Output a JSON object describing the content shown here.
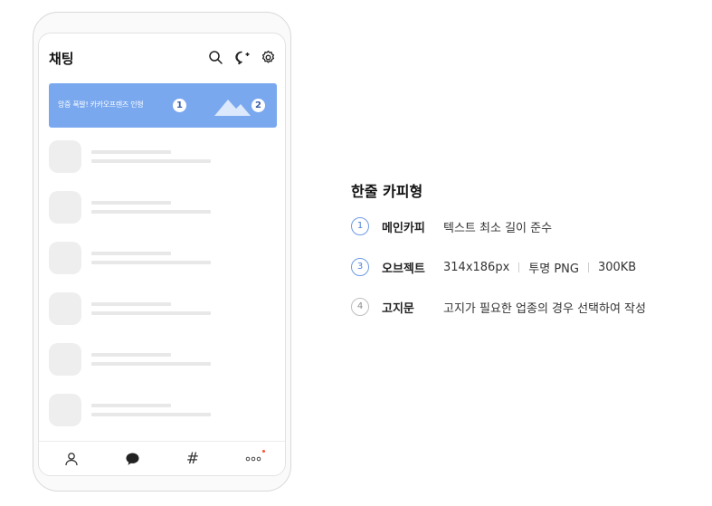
{
  "phone": {
    "title": "채팅",
    "banner_text": "앙증 폭발! 카카오프렌즈 인형",
    "banner_badge_1": "1",
    "banner_badge_2": "2",
    "chat_rows": 6,
    "tabs": [
      "friends-icon",
      "chat-bubble-icon",
      "hash-icon",
      "more-icon"
    ],
    "hash_glyph": "#"
  },
  "spec": {
    "title": "한줄 카피형",
    "rows": [
      {
        "num": "1",
        "label": "메인카피",
        "value": "텍스트 최소 길이 준수"
      },
      {
        "num": "3",
        "label": "오브젝트",
        "values": [
          "314x186px",
          "투명 PNG",
          "300KB"
        ]
      },
      {
        "num": "4",
        "label": "고지문",
        "value": "고지가 필요한 업종의 경우 선택하여 작성"
      }
    ]
  },
  "colors": {
    "banner": "#7aa8ef",
    "accent": "#4b7fd6",
    "placeholder": "#eeeeee"
  }
}
